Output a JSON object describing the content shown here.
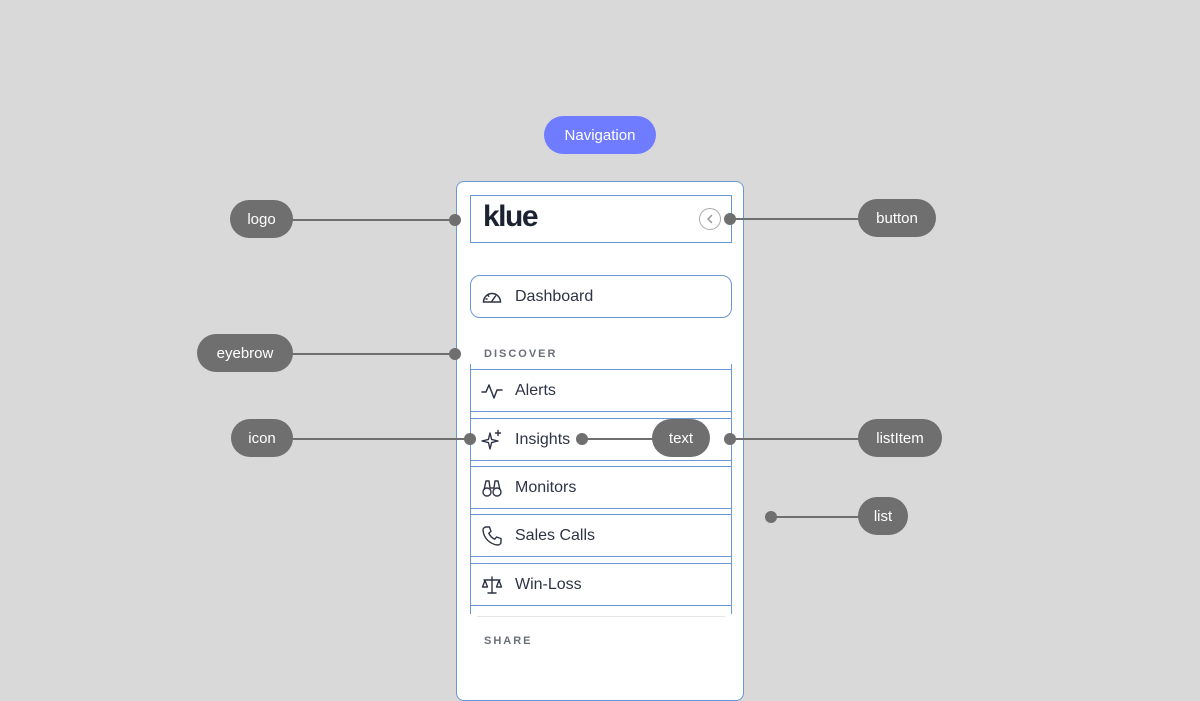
{
  "title": "Navigation",
  "nav": {
    "logo": "klue",
    "dashboard": "Dashboard",
    "eyebrow_discover": "DISCOVER",
    "items": [
      {
        "label": "Alerts",
        "icon": "activity-icon"
      },
      {
        "label": "Insights",
        "icon": "sparkle-icon"
      },
      {
        "label": "Monitors",
        "icon": "binoculars-icon"
      },
      {
        "label": "Sales Calls",
        "icon": "phone-icon"
      },
      {
        "label": "Win-Loss",
        "icon": "scale-icon"
      }
    ],
    "eyebrow_share": "SHARE"
  },
  "callouts": {
    "logo": "logo",
    "button": "button",
    "eyebrow": "eyebrow",
    "icon": "icon",
    "text": "text",
    "listItem": "listItem",
    "list": "list"
  },
  "colors": {
    "annotation": "#6f6f6f",
    "title_pill": "#6f7cff",
    "outline": "#6a98d6",
    "background": "#d9d9d9"
  }
}
